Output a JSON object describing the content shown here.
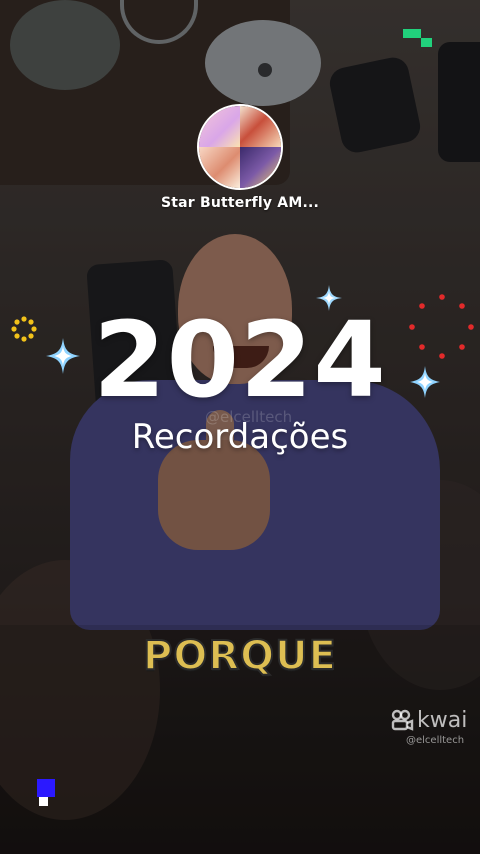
{
  "album": {
    "title": "Star Butterfly AM..."
  },
  "memory_card": {
    "year": "2024",
    "subtitle": "Recordações"
  },
  "video": {
    "caption": "PORQUE"
  },
  "watermark": {
    "brand": "kwai",
    "handle": "@elcelltech",
    "ghost_handle": "@elcelltech"
  },
  "colors": {
    "caption_fill": "#ddbe52",
    "sparkle_blue": "#8fd3ff",
    "dots_red": "#e22a2a",
    "dots_yellow": "#f2c21a",
    "corner_green": "#21d17c",
    "corner_blue": "#2b19ff"
  },
  "icons": [
    "sparkle-icon",
    "red-dot-ring-icon",
    "yellow-dot-ring-icon",
    "kwai-logo-icon"
  ]
}
